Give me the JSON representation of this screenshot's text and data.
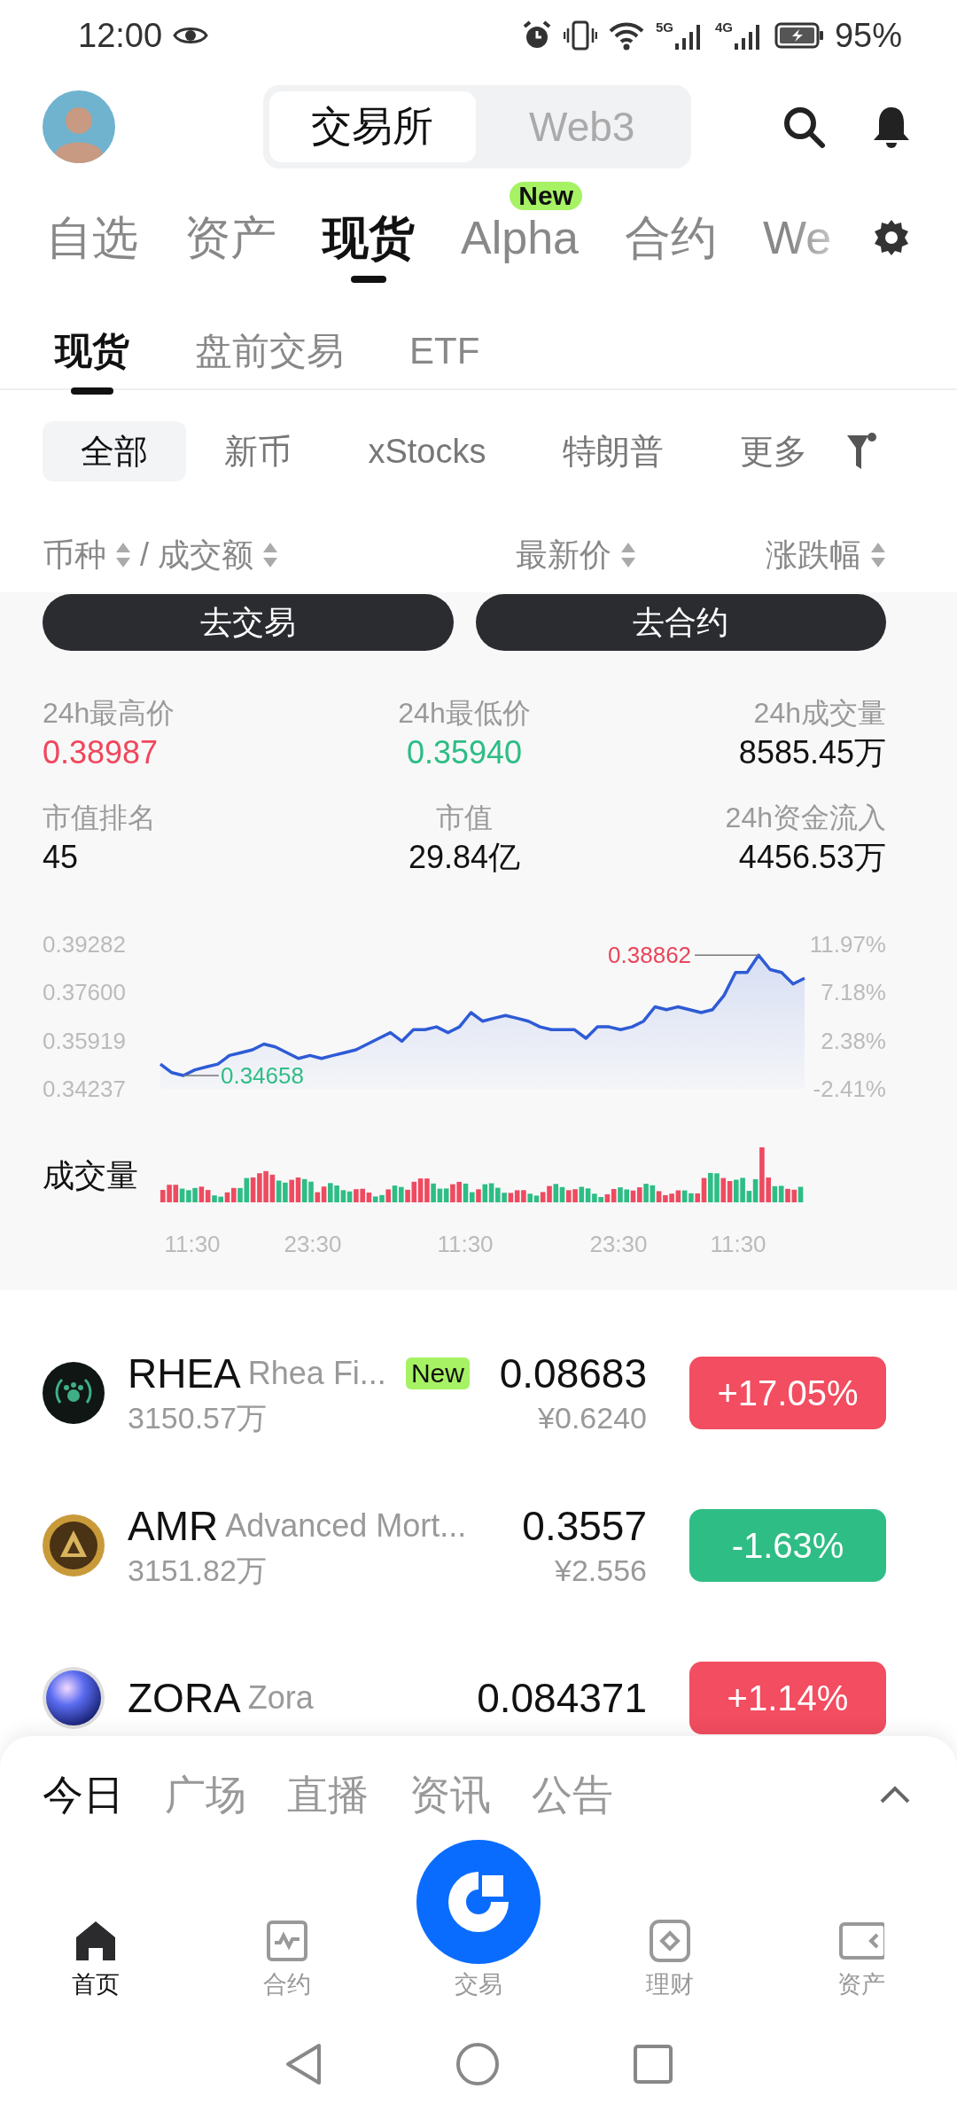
{
  "status_bar": {
    "time": "12:00",
    "network": [
      "5G",
      "4G"
    ],
    "battery": "95%"
  },
  "header": {
    "segments": [
      {
        "label": "交易所",
        "selected": true
      },
      {
        "label": "Web3",
        "selected": false
      }
    ]
  },
  "market_tabs": [
    {
      "label": "自选",
      "selected": false
    },
    {
      "label": "资产",
      "selected": false
    },
    {
      "label": "现货",
      "selected": true
    },
    {
      "label": "Alpha",
      "selected": false,
      "badge": "New"
    },
    {
      "label": "合约",
      "selected": false
    },
    {
      "label": "We",
      "selected": false
    }
  ],
  "sub_tabs": [
    {
      "label": "现货",
      "selected": true
    },
    {
      "label": "盘前交易",
      "selected": false
    },
    {
      "label": "ETF",
      "selected": false
    }
  ],
  "filters": [
    {
      "label": "全部",
      "selected": true
    },
    {
      "label": "新币",
      "selected": false
    },
    {
      "label": "xStocks",
      "selected": false
    },
    {
      "label": "特朗普",
      "selected": false
    },
    {
      "label": "更多",
      "selected": false
    }
  ],
  "columns": {
    "separator": "/",
    "items": [
      {
        "label": "币种",
        "sortable": true
      },
      {
        "label": "成交额",
        "sortable": true
      },
      {
        "label": "最新价",
        "sortable": true
      },
      {
        "label": "涨跌幅",
        "sortable": true
      }
    ]
  },
  "detail": {
    "buttons": [
      "去交易",
      "去合约"
    ],
    "stats": [
      {
        "label": "24h最高价",
        "value": "0.38987",
        "color": "#f0475b"
      },
      {
        "label": "24h最低价",
        "value": "0.35940",
        "color": "#2ebd85"
      },
      {
        "label": "24h成交量",
        "value": "8585.45万"
      },
      {
        "label": "市值排名",
        "value": "45"
      },
      {
        "label": "市值",
        "value": "29.84亿"
      },
      {
        "label": "24h资金流入",
        "value": "4456.53万"
      }
    ],
    "chart_data": {
      "type": "area",
      "ylim": [
        0.34237,
        0.39282
      ],
      "series": [
        {
          "color": "#2e5bd6",
          "values": [
            0.351,
            0.348,
            0.347,
            0.349,
            0.35,
            0.351,
            0.354,
            0.355,
            0.356,
            0.358,
            0.357,
            0.355,
            0.353,
            0.354,
            0.353,
            0.354,
            0.355,
            0.356,
            0.358,
            0.36,
            0.362,
            0.359,
            0.363,
            0.363,
            0.364,
            0.362,
            0.364,
            0.369,
            0.366,
            0.367,
            0.368,
            0.367,
            0.366,
            0.364,
            0.363,
            0.363,
            0.363,
            0.36,
            0.364,
            0.364,
            0.363,
            0.364,
            0.366,
            0.371,
            0.37,
            0.371,
            0.37,
            0.369,
            0.37,
            0.375,
            0.383,
            0.383,
            0.389,
            0.384,
            0.383,
            0.379,
            0.381
          ]
        }
      ],
      "yticks": [
        {
          "value": 0.39282,
          "label": "0.39282"
        },
        {
          "value": 0.376,
          "label": "0.37600"
        },
        {
          "value": 0.35919,
          "label": "0.35919"
        },
        {
          "value": 0.34237,
          "label": "0.34237"
        }
      ]
    },
    "high_marker": "0.38862",
    "low_marker": "0.34658",
    "percent_ticks": [
      "11.97%",
      "7.18%",
      "2.38%",
      "-2.41%"
    ],
    "time_labels": [
      "11:30",
      "23:30",
      "11:30",
      "23:30",
      "11:30"
    ],
    "volume_label": "成交量"
  },
  "coins": [
    {
      "symbol": "RHEA",
      "name": "Rhea Fi...",
      "badge": "New",
      "volume": "3150.57万",
      "price": "0.08683",
      "price_cny": "¥0.6240",
      "change": "+17.05%",
      "color": "#f24d60"
    },
    {
      "symbol": "AMR",
      "name": "Advanced Mort...",
      "volume": "3151.82万",
      "price": "0.3557",
      "price_cny": "¥2.556",
      "change": "-1.63%",
      "color": "#2ebd85"
    },
    {
      "symbol": "ZORA",
      "name": "Zora",
      "price": "0.084371",
      "change": "+1.14%",
      "color": "#f24d60"
    }
  ],
  "feed_tabs": [
    {
      "label": "今日",
      "selected": true
    },
    {
      "label": "广场",
      "selected": false
    },
    {
      "label": "直播",
      "selected": false
    },
    {
      "label": "资讯",
      "selected": false
    },
    {
      "label": "公告",
      "selected": false
    }
  ],
  "nav": [
    {
      "label": "首页",
      "selected": true,
      "kind": "tab"
    },
    {
      "label": "合约",
      "selected": false,
      "kind": "tab"
    },
    {
      "label": "交易",
      "selected": false,
      "kind": "center"
    },
    {
      "label": "理财",
      "selected": false,
      "kind": "tab"
    },
    {
      "label": "资产",
      "selected": false,
      "kind": "tab"
    }
  ]
}
